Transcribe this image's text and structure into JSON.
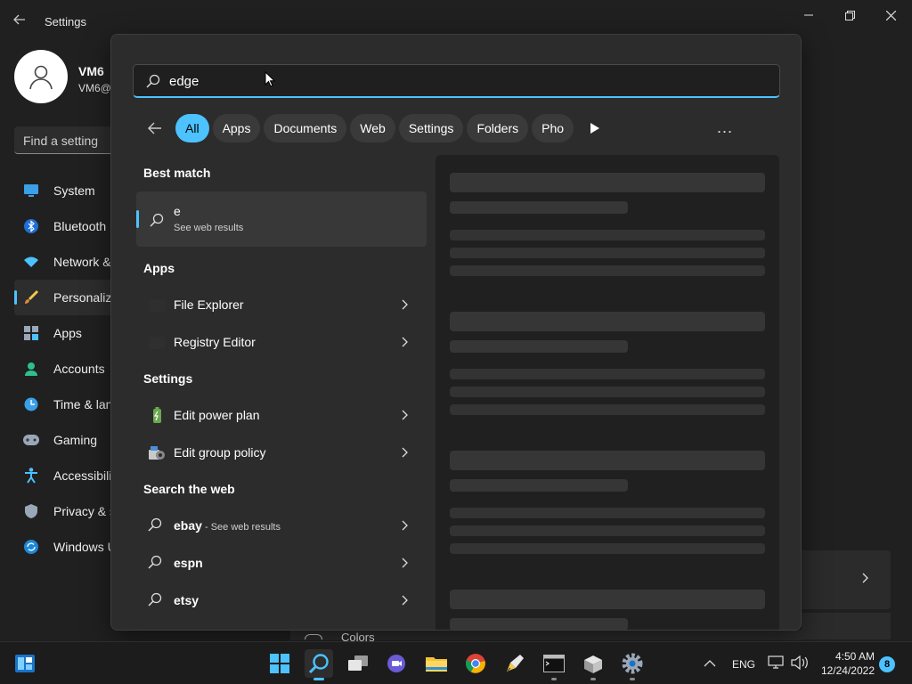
{
  "window": {
    "title": "Settings",
    "profile": {
      "name": "VM6",
      "email": "VM6@"
    },
    "find_placeholder": "Find a setting",
    "nav": [
      {
        "label": "System",
        "icon": "monitor-icon"
      },
      {
        "label": "Bluetooth",
        "icon": "bluetooth-icon"
      },
      {
        "label": "Network &",
        "icon": "wifi-icon"
      },
      {
        "label": "Personaliza",
        "icon": "brush-icon"
      },
      {
        "label": "Apps",
        "icon": "apps-icon"
      },
      {
        "label": "Accounts",
        "icon": "person-icon"
      },
      {
        "label": "Time & lan",
        "icon": "clock-icon"
      },
      {
        "label": "Gaming",
        "icon": "gamepad-icon"
      },
      {
        "label": "Accessibilit",
        "icon": "accessibility-icon"
      },
      {
        "label": "Privacy & s",
        "icon": "shield-icon"
      },
      {
        "label": "Windows U",
        "icon": "update-icon"
      }
    ],
    "colors_label": "Colors"
  },
  "search": {
    "query": "edge",
    "filters": [
      "All",
      "Apps",
      "Documents",
      "Web",
      "Settings",
      "Folders",
      "Pho"
    ],
    "more": "...",
    "best_match": {
      "header": "Best match",
      "title": "e",
      "subtitle": "See web results"
    },
    "apps_header": "Apps",
    "apps": [
      "File Explorer",
      "Registry Editor"
    ],
    "settings_header": "Settings",
    "settings": [
      "Edit power plan",
      "Edit group policy"
    ],
    "web_header": "Search the web",
    "web": [
      {
        "term": "ebay",
        "sub": " - See web results"
      },
      {
        "term": "espn",
        "sub": ""
      },
      {
        "term": "etsy",
        "sub": ""
      }
    ]
  },
  "taskbar": {
    "lang": "ENG",
    "time": "4:50 AM",
    "date": "12/24/2022",
    "notifications": "8"
  },
  "colors": {
    "accent": "#4cc2ff",
    "background": "#202020",
    "flyout": "#2c2c2c"
  }
}
